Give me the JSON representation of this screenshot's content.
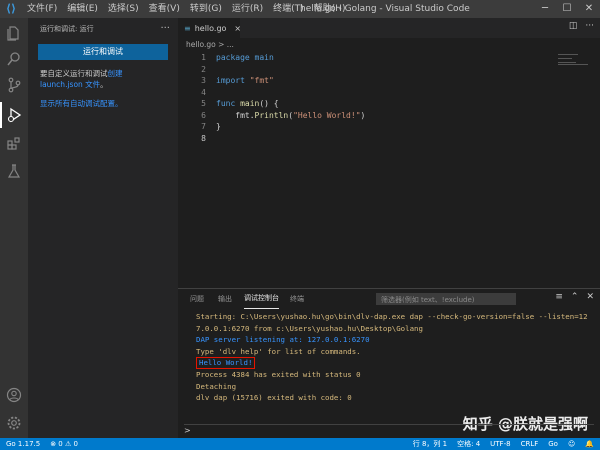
{
  "window": {
    "title": "hello.go - Golang - Visual Studio Code"
  },
  "menu": [
    "文件(F)",
    "编辑(E)",
    "选择(S)",
    "查看(V)",
    "转到(G)",
    "运行(R)",
    "终端(T)",
    "帮助(H)"
  ],
  "sidebar": {
    "header": "运行和调试: 运行",
    "run_button": "运行和调试",
    "text_before": "要自定义运行和调试",
    "link": "创建 launch.json 文件",
    "text_after": "。",
    "show_all": "显示所有自动调试配置。"
  },
  "editor": {
    "tab": "hello.go",
    "breadcrumb": "hello.go > ...",
    "lines": [
      {
        "n": "1",
        "segs": [
          {
            "t": "package main",
            "c": "kw"
          }
        ]
      },
      {
        "n": "2",
        "segs": []
      },
      {
        "n": "3",
        "segs": [
          {
            "t": "import ",
            "c": "kw"
          },
          {
            "t": "\"fmt\"",
            "c": "str"
          }
        ]
      },
      {
        "n": "4",
        "segs": []
      },
      {
        "n": "5",
        "segs": [
          {
            "t": "func ",
            "c": "kw"
          },
          {
            "t": "main",
            "c": "fn"
          },
          {
            "t": "() {",
            "c": "pl"
          }
        ]
      },
      {
        "n": "6",
        "segs": [
          {
            "t": "    fmt.",
            "c": "pl"
          },
          {
            "t": "Println",
            "c": "fn"
          },
          {
            "t": "(",
            "c": "pl"
          },
          {
            "t": "\"Hello World!\"",
            "c": "str"
          },
          {
            "t": ")",
            "c": "pl"
          }
        ]
      },
      {
        "n": "7",
        "segs": [
          {
            "t": "}",
            "c": "pl"
          }
        ]
      },
      {
        "n": "8",
        "segs": []
      }
    ]
  },
  "panel": {
    "tabs": [
      "问题",
      "输出",
      "调试控制台",
      "终端"
    ],
    "filter_placeholder": "筛选器(例如 text、!exclude)",
    "console": [
      {
        "t": "Starting: C:\\Users\\yushao.hu\\go\\bin\\dlv-dap.exe dap --check-go-version=false --listen=12",
        "c": "c-or"
      },
      {
        "t": "7.0.0.1:6270 from c:\\Users\\yushao.hu\\Desktop\\Golang",
        "c": "c-or"
      },
      {
        "t": "DAP server listening at: 127.0.0.1:6270",
        "c": "c-bl"
      },
      {
        "t": "Type 'dlv help' for list of commands.",
        "c": "c-or"
      },
      {
        "t": "Hello World!",
        "c": "c-bl",
        "highlight": true
      },
      {
        "t": "Process 4384 has exited with status 0",
        "c": "c-or"
      },
      {
        "t": "Detaching",
        "c": "c-or"
      },
      {
        "t": "dlv dap (15716) exited with code: 0",
        "c": "c-or"
      }
    ],
    "prompt": ">",
    "watermark": "知乎 @朕就是强啊"
  },
  "statusbar": {
    "go_version": "Go 1.17.5",
    "problems": "⊗ 0 ⚠ 0",
    "position": "行 8，列 1",
    "spaces": "空格: 4",
    "encoding": "UTF-8",
    "eol": "CRLF",
    "language": "Go"
  }
}
